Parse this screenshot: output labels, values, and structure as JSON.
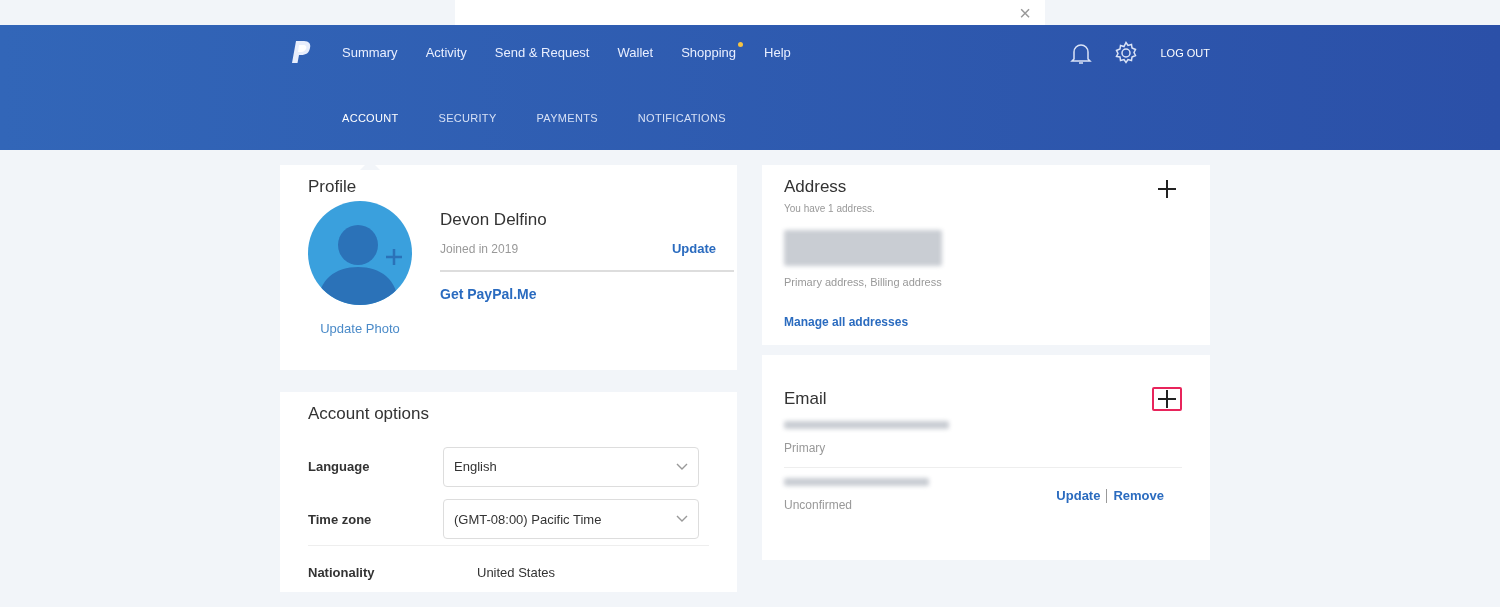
{
  "dialog": {
    "close": "×"
  },
  "header": {
    "nav": [
      {
        "label": "Summary",
        "dot": false
      },
      {
        "label": "Activity",
        "dot": false
      },
      {
        "label": "Send & Request",
        "dot": false
      },
      {
        "label": "Wallet",
        "dot": false
      },
      {
        "label": "Shopping",
        "dot": true
      },
      {
        "label": "Help",
        "dot": false
      }
    ],
    "logout": "LOG OUT"
  },
  "subtabs": [
    {
      "label": "ACCOUNT",
      "selected": true
    },
    {
      "label": "SECURITY",
      "selected": false
    },
    {
      "label": "PAYMENTS",
      "selected": false
    },
    {
      "label": "NOTIFICATIONS",
      "selected": false
    }
  ],
  "profile": {
    "title": "Profile",
    "name": "Devon Delfino",
    "joined": "Joined in 2019",
    "update": "Update",
    "paypal_me": "Get PayPal.Me",
    "update_photo": "Update Photo"
  },
  "account_options": {
    "title": "Account options",
    "rows": [
      {
        "kind": "select",
        "label": "Language",
        "value": "English"
      },
      {
        "kind": "select",
        "label": "Time zone",
        "value": "(GMT-08:00) Pacific Time"
      },
      {
        "kind": "text",
        "label": "Nationality",
        "value": "United States"
      }
    ]
  },
  "address": {
    "title": "Address",
    "subtitle": "You have 1 address.",
    "add_highlighted": false,
    "note": "Primary address, Billing address",
    "link": "Manage all addresses"
  },
  "email": {
    "title": "Email",
    "add_highlighted": true,
    "items": [
      {
        "status": "Primary"
      },
      {
        "status": "Unconfirmed",
        "actions": [
          "Update",
          "Remove"
        ]
      }
    ]
  }
}
